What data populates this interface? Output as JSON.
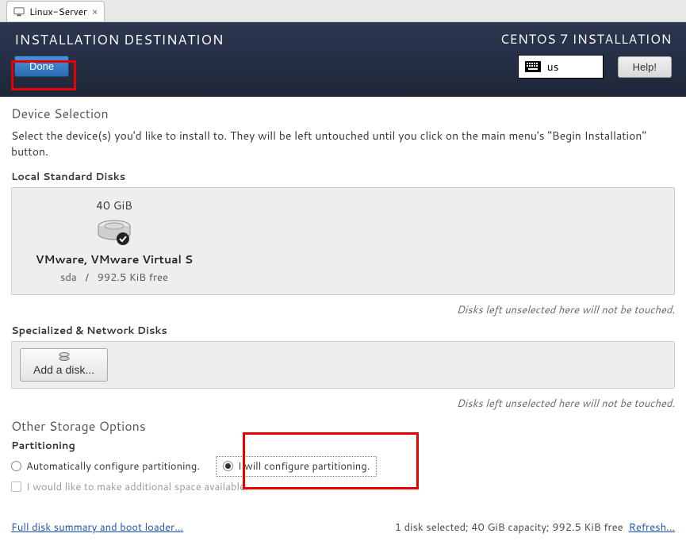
{
  "tab": {
    "label": "Linux-Server"
  },
  "header": {
    "title": "INSTALLATION DESTINATION",
    "done": "Done",
    "distro": "CENTOS 7 INSTALLATION",
    "lang": "us",
    "help": "Help!"
  },
  "device": {
    "heading": "Device Selection",
    "intro": "Select the device(s) you'd like to install to.  They will be left untouched until you click on the main menu's \"Begin Installation\" button.",
    "local_h": "Local Standard Disks",
    "disk": {
      "size": "40 GiB",
      "name": "VMware, VMware Virtual S",
      "dev": "sda",
      "sep": "/",
      "free": "992.5 KiB free"
    },
    "note": "Disks left unselected here will not be touched.",
    "net_h": "Specialized & Network Disks",
    "add_disk": "Add a disk..."
  },
  "storage": {
    "heading": "Other Storage Options",
    "part_h": "Partitioning",
    "auto": "Automatically configure partitioning.",
    "manual": "I will configure partitioning.",
    "addspace": "I would like to make additional space available."
  },
  "footer": {
    "summary": "Full disk summary and boot loader...",
    "status": "1 disk selected; 40 GiB capacity; 992.5 KiB free",
    "refresh": "Refresh..."
  }
}
